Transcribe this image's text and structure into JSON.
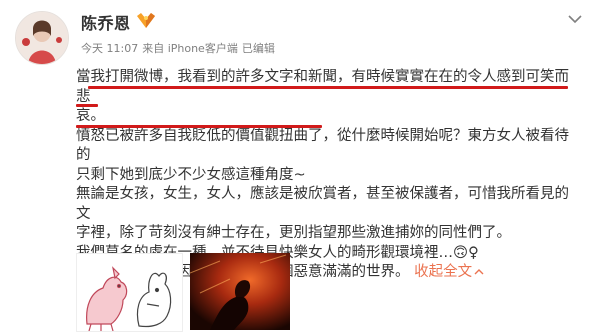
{
  "user": {
    "name": "陈乔恩",
    "verified": "vip"
  },
  "meta": {
    "date": "今天 11:07",
    "source": "来自 iPhone客户端",
    "edited": "已编辑"
  },
  "post": {
    "lines": [
      "當我打開微博，我看到的許多文字和新聞，有時候實實在在的令人感到可笑而悲",
      "哀。",
      "憤怒已被許多自我貶低的價值觀扭曲了，從什麼時候開始呢？東方女人被看待的",
      "只剩下她到底少不少女感這種角度~",
      "無論是女孩，女生，女人，應該是被欣賞者，甚至被保護者，可惜我所看見的文",
      "字裡，除了苛刻沒有紳士存在，更別指望那些激進捕妳的同性們了。",
      "我們莫名的處在一種，並不待見快樂女人的畸形觀環境裡…🙃♀",
      "好好疼愛自己，因為我們處在一個惡意滿滿的世界。"
    ],
    "expand_label": "收起全文"
  },
  "colors": {
    "underline": "#d11a1a",
    "link": "#eb7350",
    "meta": "#808080"
  },
  "icons": [
    "avatar",
    "vip-badge-icon",
    "chevron-down-icon",
    "chevron-up-icon"
  ]
}
